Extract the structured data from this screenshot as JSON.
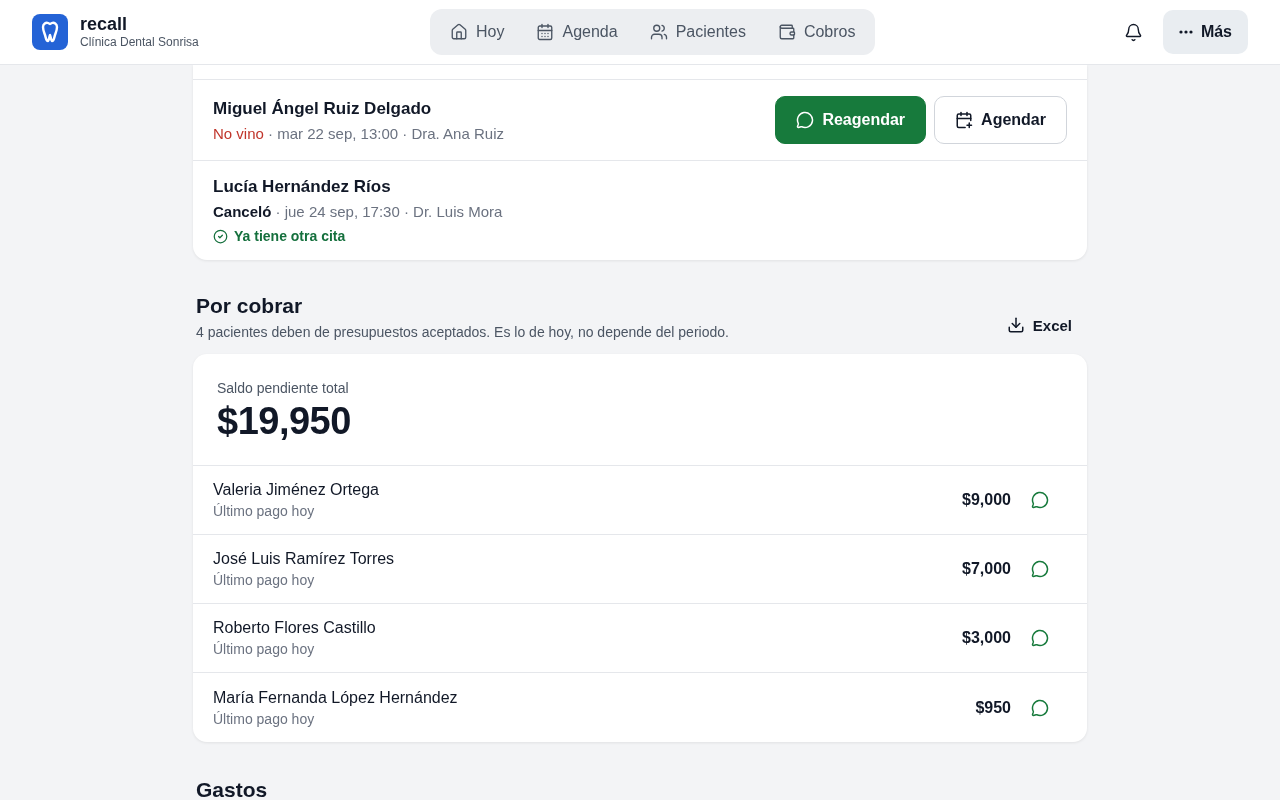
{
  "header": {
    "brand": "recall",
    "clinic": "Clínica Dental Sonrisa",
    "nav": [
      {
        "label": "Hoy",
        "kind": "home",
        "selected": false
      },
      {
        "label": "Agenda",
        "kind": "calendar",
        "selected": false
      },
      {
        "label": "Pacientes",
        "kind": "users",
        "selected": false
      },
      {
        "label": "Cobros",
        "kind": "wallet",
        "selected": false
      }
    ],
    "more_button": "Más"
  },
  "recall_list": [
    {
      "name": "Miguel Ángel Ruiz Delgado",
      "status": "No vino",
      "kind": "missed",
      "detail": "· mar 22 sep, 13:00 · Dra. Ana Ruiz",
      "actions": [
        {
          "label": "Reagendar",
          "kind": "primary"
        },
        {
          "label": "Agendar",
          "kind": "secondary"
        }
      ]
    },
    {
      "name": "Lucía Hernández Ríos",
      "status": "Canceló",
      "kind": "cancelled",
      "detail": "· jue 24 sep, 17:30 · Dr. Luis Mora",
      "note": "Ya tiene otra cita"
    }
  ],
  "receivables": {
    "title": "Por cobrar",
    "subtitle": "4 pacientes deben de presupuestos aceptados. Es lo de hoy, no depende del periodo.",
    "export_button": "Excel",
    "total_label": "Saldo pendiente total",
    "total": "$19,950",
    "rows": [
      {
        "name": "Valeria Jiménez Ortega",
        "last_payment": "Último pago hoy",
        "amount": "$9,000"
      },
      {
        "name": "José Luis Ramírez Torres",
        "last_payment": "Último pago hoy",
        "amount": "$7,000"
      },
      {
        "name": "Roberto Flores Castillo",
        "last_payment": "Último pago hoy",
        "amount": "$3,000"
      },
      {
        "name": "María Fernanda López Hernández",
        "last_payment": "Último pago hoy",
        "amount": "$950"
      }
    ]
  },
  "next_section": {
    "title": "Gastos"
  }
}
